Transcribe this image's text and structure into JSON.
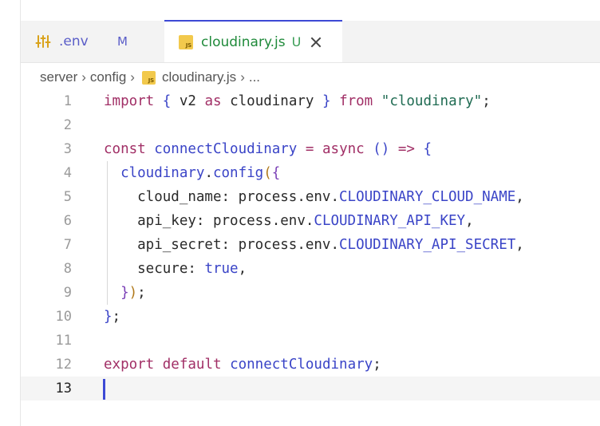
{
  "tabs": [
    {
      "label": ".env",
      "status": "M",
      "icon": "settings-icon"
    },
    {
      "label": "cloudinary.js",
      "status": "U",
      "icon": "js-icon"
    }
  ],
  "js_icon_text": "JS",
  "breadcrumb": [
    "server",
    "config",
    "cloudinary.js",
    "..."
  ],
  "line_numbers": [
    "1",
    "2",
    "3",
    "4",
    "5",
    "6",
    "7",
    "8",
    "9",
    "10",
    "11",
    "12",
    "13"
  ],
  "code_tokens": [
    [
      [
        "kw",
        "import"
      ],
      [
        "pl",
        " "
      ],
      [
        "pc",
        "{"
      ],
      [
        "pl",
        " v2 "
      ],
      [
        "kw",
        "as"
      ],
      [
        "pl",
        " cloudinary "
      ],
      [
        "pc",
        "}"
      ],
      [
        "pl",
        " "
      ],
      [
        "kw",
        "from"
      ],
      [
        "pl",
        " "
      ],
      [
        "str",
        "\"cloudinary\""
      ],
      [
        "pl",
        ";"
      ]
    ],
    [],
    [
      [
        "kw",
        "const"
      ],
      [
        "pl",
        " "
      ],
      [
        "fn",
        "connectCloudinary"
      ],
      [
        "pl",
        " "
      ],
      [
        "kw",
        "="
      ],
      [
        "pl",
        " "
      ],
      [
        "kw",
        "async"
      ],
      [
        "pl",
        " "
      ],
      [
        "pc",
        "()"
      ],
      [
        "pl",
        " "
      ],
      [
        "kw",
        "=>"
      ],
      [
        "pl",
        " "
      ],
      [
        "pc",
        "{"
      ]
    ],
    [
      [
        "pl",
        "  "
      ],
      [
        "fn",
        "cloudinary"
      ],
      [
        "pl",
        "."
      ],
      [
        "fn",
        "config"
      ],
      [
        "pa",
        "("
      ],
      [
        "pb",
        "{"
      ]
    ],
    [
      [
        "pl",
        "    cloud_name: process.env."
      ],
      [
        "const",
        "CLOUDINARY_CLOUD_NAME"
      ],
      [
        "pl",
        ","
      ]
    ],
    [
      [
        "pl",
        "    api_key: process.env."
      ],
      [
        "const",
        "CLOUDINARY_API_KEY"
      ],
      [
        "pl",
        ","
      ]
    ],
    [
      [
        "pl",
        "    api_secret: process.env."
      ],
      [
        "const",
        "CLOUDINARY_API_SECRET"
      ],
      [
        "pl",
        ","
      ]
    ],
    [
      [
        "pl",
        "    secure: "
      ],
      [
        "bool",
        "true"
      ],
      [
        "pl",
        ","
      ]
    ],
    [
      [
        "pl",
        "  "
      ],
      [
        "pb",
        "}"
      ],
      [
        "pa",
        ")"
      ],
      [
        "pl",
        ";"
      ]
    ],
    [
      [
        "pc",
        "}"
      ],
      [
        "pl",
        ";"
      ]
    ],
    [],
    [
      [
        "kw",
        "export"
      ],
      [
        "pl",
        " "
      ],
      [
        "kw",
        "default"
      ],
      [
        "pl",
        " "
      ],
      [
        "fn",
        "connectCloudinary"
      ],
      [
        "pl",
        ";"
      ]
    ],
    []
  ],
  "colors": {
    "accent": "#3d4ad5",
    "keyword": "#a12f66",
    "function": "#3a44c7",
    "string": "#1f6b52",
    "modified": "#5a5dc8",
    "untracked": "#3a9d55"
  },
  "current_line": 13
}
